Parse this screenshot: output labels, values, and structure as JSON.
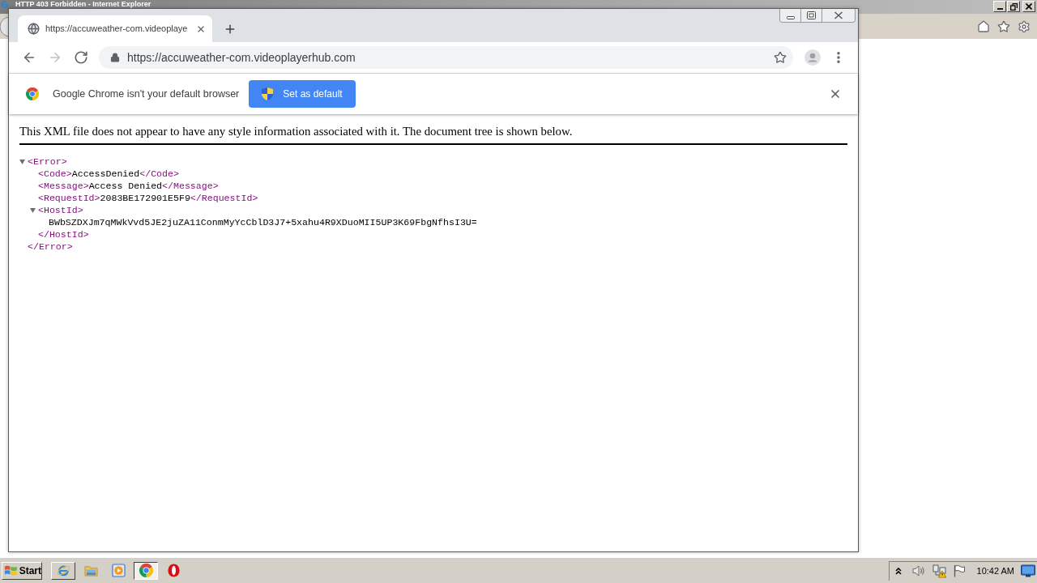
{
  "ie_window": {
    "title": "HTTP 403 Forbidden - Internet Explorer"
  },
  "browser": {
    "tabs": [
      {
        "title": "https://accuweather-com.videoplaye",
        "selected": true
      }
    ],
    "nav_buttons": [
      {
        "kind": "back",
        "disabled": false
      },
      {
        "kind": "forward",
        "disabled": true
      },
      {
        "kind": "reload",
        "disabled": false
      }
    ],
    "address_bar": {
      "url": "https://accuweather-com.videoplayerhub.com"
    },
    "infobar": {
      "message": "Google Chrome isn't your default browser",
      "button": "Set as default"
    }
  },
  "page": {
    "notice": "This XML file does not appear to have any style information associated with it. The document tree is shown below.",
    "xml_tree": [
      {
        "kind": "block",
        "open_tag": "<Error>",
        "close_tag": "</Error>",
        "expanded": true,
        "children": [
          {
            "kind": "inline",
            "open_tag": "<Code>",
            "text": "AccessDenied",
            "close_tag": "</Code>"
          },
          {
            "kind": "inline",
            "open_tag": "<Message>",
            "text": "Access Denied",
            "close_tag": "</Message>"
          },
          {
            "kind": "inline",
            "open_tag": "<RequestId>",
            "text": "2083BE172901E5F9",
            "close_tag": "</RequestId>"
          },
          {
            "kind": "block",
            "open_tag": "<HostId>",
            "close_tag": "</HostId>",
            "expanded": true,
            "children": [
              {
                "kind": "text",
                "text": "BWbSZDXJm7qMWkVvd5JE2juZA11ConmMyYcCblD3J7+5xahu4R9XDuoMII5UP3K69FbgNfhsI3U="
              }
            ]
          }
        ]
      }
    ]
  },
  "taskbar": {
    "start_button": "Start",
    "items": [
      {
        "kind": "task",
        "selected": false
      },
      {
        "kind": "launcher"
      },
      {
        "kind": "launcher"
      },
      {
        "kind": "task",
        "selected": true
      },
      {
        "kind": "launcher"
      }
    ],
    "clock": "10:42 AM"
  }
}
